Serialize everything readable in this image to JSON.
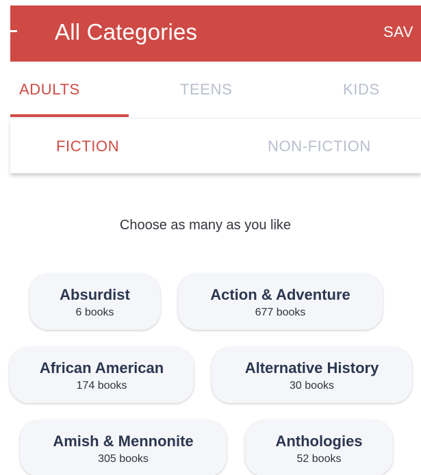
{
  "header": {
    "title": "All Categories",
    "save_label": "SAV",
    "back_icon": "back-arrow-icon",
    "color": "#cf4a45"
  },
  "age_tabs": [
    {
      "label": "ADULTS",
      "active": true
    },
    {
      "label": "TEENS",
      "active": false
    },
    {
      "label": "KIDS",
      "active": false
    }
  ],
  "genre_tabs": [
    {
      "label": "FICTION",
      "active": true
    },
    {
      "label": "NON-FICTION",
      "active": false
    }
  ],
  "subtitle": "Choose as many as you like",
  "categories": [
    {
      "name": "Absurdist",
      "count": "6 books"
    },
    {
      "name": "Action & Adventure",
      "count": "677 books"
    },
    {
      "name": "African American",
      "count": "174 books"
    },
    {
      "name": "Alternative History",
      "count": "30 books"
    },
    {
      "name": "Amish & Mennonite",
      "count": "305 books"
    },
    {
      "name": "Anthologies",
      "count": "52 books"
    }
  ],
  "colors": {
    "accent": "#cf4a45",
    "inactive_tab": "#b9bfcd",
    "chip_background": "#f5f6f9",
    "chip_title": "#2c3650"
  }
}
